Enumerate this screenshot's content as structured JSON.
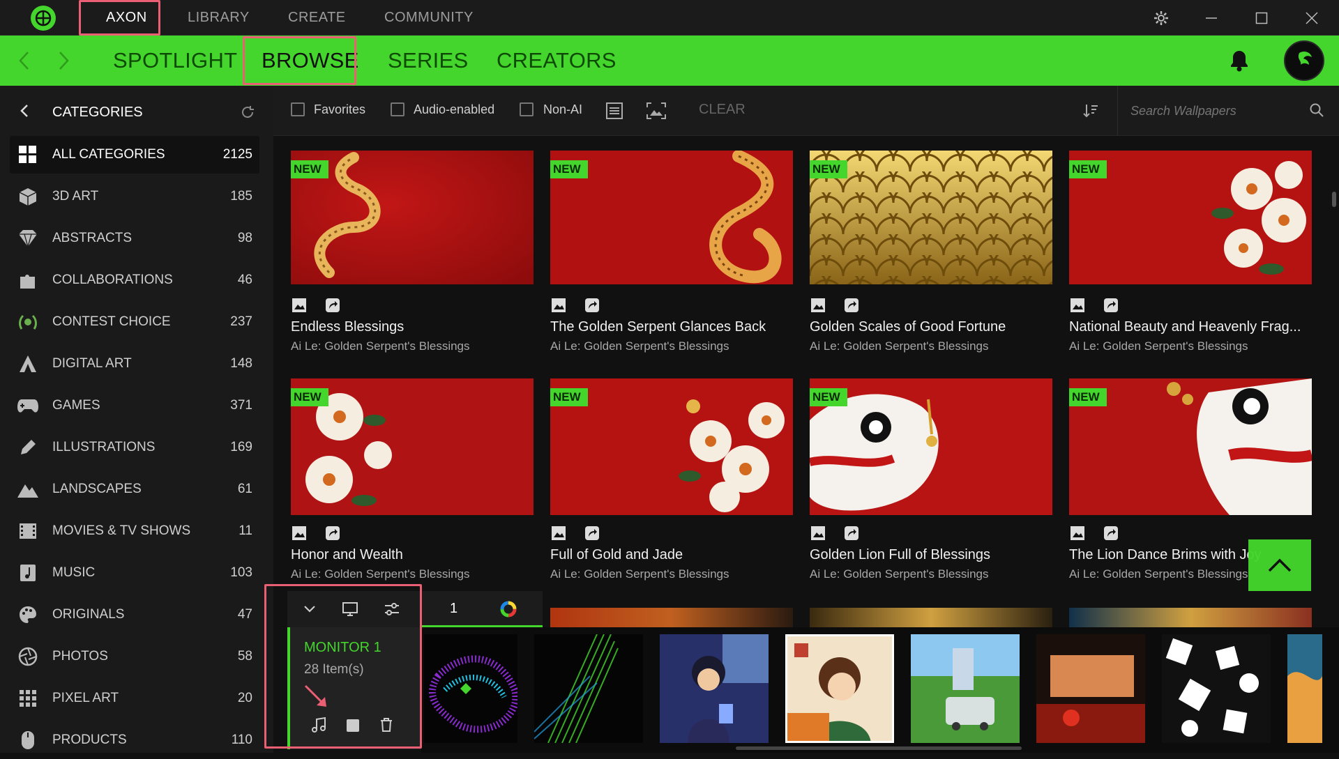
{
  "topnav": {
    "items": [
      "AXON",
      "LIBRARY",
      "CREATE",
      "COMMUNITY"
    ]
  },
  "nav": {
    "tabs": [
      "SPOTLIGHT",
      "BROWSE",
      "SERIES",
      "CREATORS"
    ]
  },
  "sidebar": {
    "header": "CATEGORIES",
    "items": [
      {
        "label": "ALL CATEGORIES",
        "count": "2125",
        "icon": "grid-icon"
      },
      {
        "label": "3D ART",
        "count": "185",
        "icon": "cube-icon"
      },
      {
        "label": "ABSTRACTS",
        "count": "98",
        "icon": "diamond-icon"
      },
      {
        "label": "COLLABORATIONS",
        "count": "46",
        "icon": "puzzle-icon"
      },
      {
        "label": "CONTEST CHOICE",
        "count": "237",
        "icon": "laurel-icon"
      },
      {
        "label": "DIGITAL ART",
        "count": "148",
        "icon": "digital-art-icon"
      },
      {
        "label": "GAMES",
        "count": "371",
        "icon": "gamepad-icon"
      },
      {
        "label": "ILLUSTRATIONS",
        "count": "169",
        "icon": "pencil-icon"
      },
      {
        "label": "LANDSCAPES",
        "count": "61",
        "icon": "mountain-icon"
      },
      {
        "label": "MOVIES & TV SHOWS",
        "count": "11",
        "icon": "film-icon"
      },
      {
        "label": "MUSIC",
        "count": "103",
        "icon": "music-note-icon"
      },
      {
        "label": "ORIGINALS",
        "count": "47",
        "icon": "palette-icon"
      },
      {
        "label": "PHOTOS",
        "count": "58",
        "icon": "aperture-icon"
      },
      {
        "label": "PIXEL ART",
        "count": "20",
        "icon": "pixel-grid-icon"
      },
      {
        "label": "PRODUCTS",
        "count": "110",
        "icon": "mouse-icon"
      }
    ]
  },
  "filters": {
    "favorites": "Favorites",
    "audio": "Audio-enabled",
    "nonai": "Non-AI",
    "clear": "CLEAR",
    "search_placeholder": "Search Wallpapers"
  },
  "cards": [
    {
      "badge": "NEW",
      "title": "Endless Blessings",
      "subtitle": "Ai Le: Golden Serpent's Blessings"
    },
    {
      "badge": "NEW",
      "title": "The Golden Serpent Glances Back",
      "subtitle": "Ai Le: Golden Serpent's Blessings"
    },
    {
      "badge": "NEW",
      "title": "Golden Scales of Good Fortune",
      "subtitle": "Ai Le: Golden Serpent's Blessings"
    },
    {
      "badge": "NEW",
      "title": "National Beauty and Heavenly Frag...",
      "subtitle": "Ai Le: Golden Serpent's Blessings"
    },
    {
      "badge": "NEW",
      "title": "Honor and Wealth",
      "subtitle": "Ai Le: Golden Serpent's Blessings"
    },
    {
      "badge": "NEW",
      "title": "Full of Gold and Jade",
      "subtitle": "Ai Le: Golden Serpent's Blessings"
    },
    {
      "badge": "NEW",
      "title": "Golden Lion Full of Blessings",
      "subtitle": "Ai Le: Golden Serpent's Blessings"
    },
    {
      "badge": "NEW",
      "title": "The Lion Dance Brims with Joy",
      "subtitle": "Ai Le: Golden Serpent's Blessings"
    }
  ],
  "playlist": {
    "page": "1",
    "monitor": "MONITOR 1",
    "items": "28 Item(s)"
  },
  "colors": {
    "accent": "#44d62c",
    "highlight": "#ea5f73"
  }
}
